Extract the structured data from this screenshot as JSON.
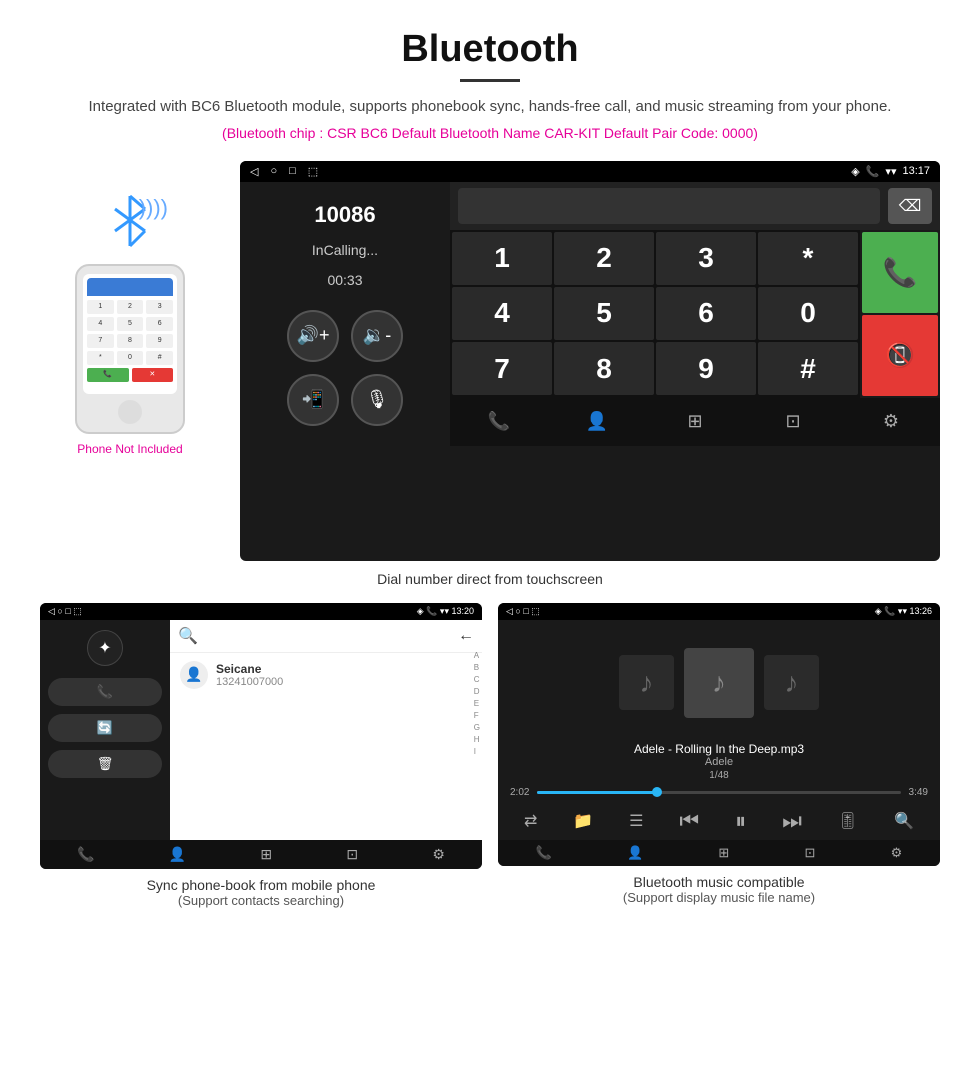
{
  "header": {
    "title": "Bluetooth",
    "description": "Integrated with BC6 Bluetooth module, supports phonebook sync, hands-free call, and music streaming from your phone.",
    "specs": "(Bluetooth chip : CSR BC6    Default Bluetooth Name CAR-KIT    Default Pair Code: 0000)"
  },
  "dialer_screen": {
    "statusbar_time": "13:17",
    "caller_number": "10086",
    "call_status": "InCalling...",
    "call_timer": "00:33",
    "keys": [
      "1",
      "2",
      "3",
      "*",
      "4",
      "5",
      "6",
      "0",
      "7",
      "8",
      "9",
      "#"
    ],
    "caption": "Dial number direct from touchscreen"
  },
  "phonebook_screen": {
    "statusbar_time": "13:20",
    "contact_name": "Seicane",
    "contact_number": "13241007000",
    "alpha_index": [
      "A",
      "B",
      "C",
      "D",
      "E",
      "F",
      "G",
      "H",
      "I"
    ],
    "caption_main": "Sync phone-book from mobile phone",
    "caption_sub": "(Support contacts searching)"
  },
  "music_screen": {
    "statusbar_time": "13:26",
    "song_title": "Adele - Rolling In the Deep.mp3",
    "artist": "Adele",
    "track_counter": "1/48",
    "time_current": "2:02",
    "time_total": "3:49",
    "caption_main": "Bluetooth music compatible",
    "caption_sub": "(Support display music file name)"
  },
  "phone_not_included": "Phone Not Included",
  "icons": {
    "bluetooth": "✦",
    "call": "📞",
    "volume_up": "🔊",
    "volume_down": "🔉",
    "transfer": "📲",
    "mic": "🎙",
    "phone_green": "📞",
    "phone_red": "📵"
  }
}
